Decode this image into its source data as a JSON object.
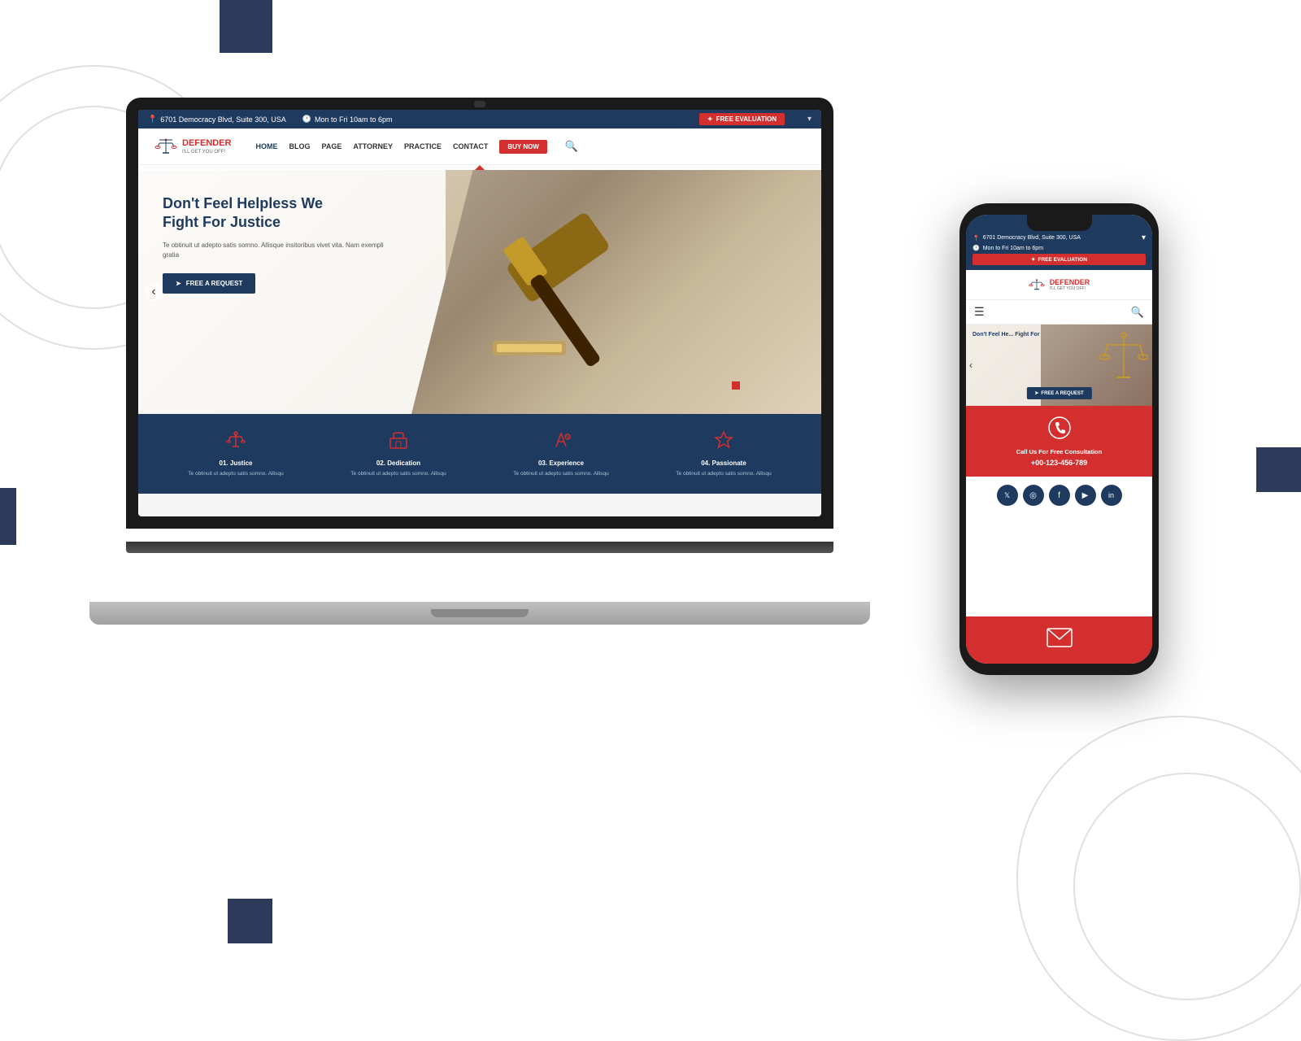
{
  "background": {
    "color": "#ffffff"
  },
  "laptop": {
    "topbar": {
      "address": "6701 Democracy Blvd, Suite 300, USA",
      "hours": "Mon to Fri 10am to 6pm",
      "cta": "FREE EVALUATION"
    },
    "navbar": {
      "brand": "DEFENDER",
      "tagline": "I'LL GET YOU OFF!",
      "links": [
        "HOME",
        "BLOG",
        "PAGE",
        "ATTORNEY",
        "PRACTICE",
        "CONTACT"
      ],
      "buy_btn": "BUY NOW"
    },
    "hero": {
      "title_line1": "Don't Feel Helpless We",
      "title_line2": "Fight For Justice",
      "body": "Te obtinuit ut adepto satis somno. Allisque insitoribus vivet vita. Nam exempli gratia",
      "cta": "FREE A REQUEST"
    },
    "features": [
      {
        "number": "01.",
        "title": "Justice",
        "text": "Te obtinuit ut adepto satis somno. Allisqu"
      },
      {
        "number": "02.",
        "title": "Dedication",
        "text": "Te obtinuit ut adepto satis somno. Allisqu"
      },
      {
        "number": "03.",
        "title": "Experience",
        "text": "Te obtinuit ut adepto satis somno. Allisqu"
      },
      {
        "number": "04.",
        "title": "Passionate",
        "text": "Te obtinuit ut adepto satis somno. Allisqu"
      }
    ]
  },
  "phone": {
    "topbar": {
      "address": "6701 Democracy Blvd, Suite 300, USA",
      "hours": "Mon to Fri 10am to 6pm",
      "cta": "FREE EVALUATION"
    },
    "brand": "DEFENDER",
    "tagline": "I'LL GET YOU OFF!",
    "hero": {
      "title": "Don't Feel He... Fight For",
      "cta": "FREE A REQUEST"
    },
    "consult": {
      "title": "Call Us For Free Consultation",
      "phone": "+00-123-456-789"
    },
    "social": [
      "𝕏",
      "◎",
      "f",
      "▶",
      "in"
    ]
  }
}
